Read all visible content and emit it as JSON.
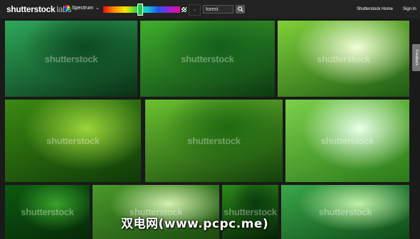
{
  "header": {
    "logo": "shutterstock",
    "logo_suffix": "labs",
    "spectrum_label": "Spectrum",
    "search_value": "forest",
    "home_link": "Shutterstock Home",
    "signin_link": "Sign In",
    "spectrum_hue": 0.48
  },
  "feedback_label": "Feedback",
  "watermark": "shutterstock",
  "caption": "双电网(www.pcpc.me)",
  "photos": [
    {
      "name": "photo-misty-forest",
      "colors": [
        "#0e4a22",
        "#2ea85a",
        "#0a3015"
      ]
    },
    {
      "name": "photo-ivy-leaves",
      "colors": [
        "#14601c",
        "#3fae2e",
        "#0c3a12"
      ]
    },
    {
      "name": "photo-tree-trunk-sun",
      "colors": [
        "#f2ffd8",
        "#7fd03a",
        "#1f5a14"
      ]
    },
    {
      "name": "photo-leaf-closeup",
      "colors": [
        "#9ad43a",
        "#3b8a12",
        "#0f3a08"
      ]
    },
    {
      "name": "photo-fern",
      "colors": [
        "#1f6a12",
        "#6cc230",
        "#123f0a"
      ]
    },
    {
      "name": "photo-leaves-sky",
      "colors": [
        "#e8ffe8",
        "#7cd04a",
        "#2a7a1a"
      ]
    },
    {
      "name": "photo-green-plant",
      "colors": [
        "#38a02a",
        "#0c5a10",
        "#062a08"
      ]
    },
    {
      "name": "photo-wild-flowers",
      "colors": [
        "#d4f0b0",
        "#4a9a2a",
        "#1c4a10"
      ]
    },
    {
      "name": "photo-flower-bud",
      "colors": [
        "#0a3a0c",
        "#2a8a1a",
        "#062006"
      ]
    },
    {
      "name": "photo-bamboo",
      "colors": [
        "#bff0a8",
        "#3aa84a",
        "#0f4a18"
      ]
    }
  ]
}
